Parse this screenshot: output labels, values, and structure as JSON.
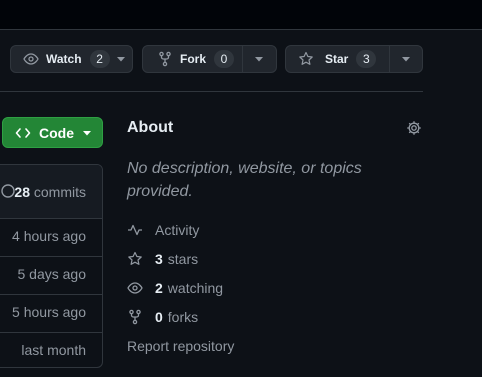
{
  "repo_actions": {
    "watch": {
      "label": "Watch",
      "count": "2"
    },
    "fork": {
      "label": "Fork",
      "count": "0"
    },
    "star": {
      "label": "Star",
      "count": "3"
    }
  },
  "code_button": {
    "label": "Code"
  },
  "file_list": {
    "commits_count": "28",
    "commits_label": "commits",
    "rows": [
      "4 hours ago",
      "5 days ago",
      "5 hours ago",
      "last month"
    ]
  },
  "about": {
    "title": "About",
    "description": "No description, website, or topics provided.",
    "activity": "Activity",
    "stars_count": "3",
    "stars_label": "stars",
    "watching_count": "2",
    "watching_label": "watching",
    "forks_count": "0",
    "forks_label": "forks",
    "report": "Report repository"
  },
  "colors": {
    "background": "#0d1117",
    "code_button": "#238636",
    "muted_text": "#9198a1"
  }
}
